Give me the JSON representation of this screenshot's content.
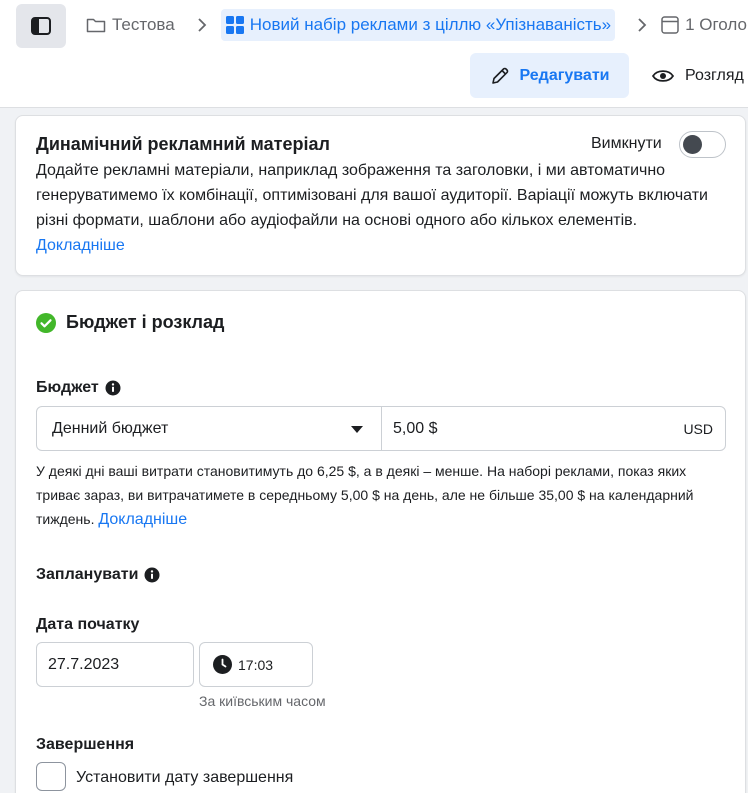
{
  "breadcrumb": {
    "campaign": "Тестова",
    "ad_set": "Новий набір реклами з ціллю «Упізнаваність»",
    "ad": "1 Оголо"
  },
  "actions": {
    "edit_label": "Редагувати",
    "view_label": "Розгляд"
  },
  "dynamic_creative": {
    "title": "Динамічний рекламний матеріал",
    "toggle_label": "Вимкнути",
    "toggle_on": false,
    "description": "Додайте рекламні матеріали, наприклад зображення та заголовки, і ми автоматично генеруватимемо їх комбінації, оптимізовані для вашої аудиторії. Варіації можуть включати різні формати, шаблони або аудіофайли на основі одного або кількох елементів.",
    "learn_more": "Докладніше"
  },
  "budget_schedule": {
    "title": "Бюджет і розклад",
    "budget_label": "Бюджет",
    "budget_type": "Денний бюджет",
    "budget_amount": "5,00 $",
    "currency": "USD",
    "note": "У деякі дні ваші витрати становитимуть до 6,25 $, а в деякі – менше. На наборі реклами, показ яких триває зараз, ви витрачатимете в середньому 5,00 $ на день, але не більше 35,00 $ на календарний тиждень.",
    "note_link": "Докладніше",
    "schedule_label": "Запланувати",
    "start_date_label": "Дата початку",
    "start_date": "27.7.2023",
    "start_time": "17:03",
    "timezone_note": "За київським часом",
    "end_label": "Завершення",
    "end_checkbox_label": "Установити дату завершення",
    "end_checked": false
  },
  "colors": {
    "accent": "#1877f2",
    "accent_bg": "#e7f0fd",
    "success": "#42b72a"
  }
}
